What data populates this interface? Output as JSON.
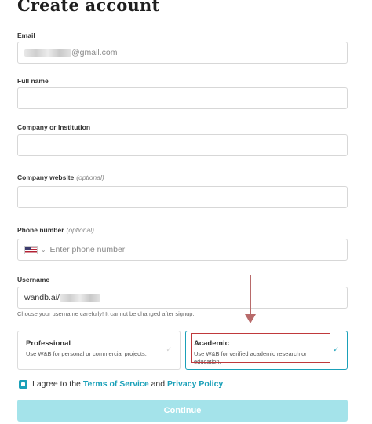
{
  "page": {
    "title": "Create account"
  },
  "fields": {
    "email": {
      "label": "Email",
      "value_suffix": "@gmail.com"
    },
    "full_name": {
      "label": "Full name",
      "value": ""
    },
    "company": {
      "label": "Company or Institution",
      "value": ""
    },
    "website": {
      "label": "Company website",
      "optional": "(optional)",
      "value": ""
    },
    "phone": {
      "label": "Phone number",
      "optional": "(optional)",
      "placeholder": "Enter phone number",
      "country_icon": "us-flag-icon",
      "chevron": "⌄"
    },
    "username": {
      "label": "Username",
      "prefix": "wandb.ai/",
      "hint": "Choose your username carefully! It cannot be changed after signup."
    }
  },
  "account_types": [
    {
      "title": "Professional",
      "description": "Use W&B for personal or commercial projects.",
      "selected": false
    },
    {
      "title": "Academic",
      "description": "Use W&B for verified academic research or education.",
      "selected": true
    }
  ],
  "agreement": {
    "prefix": "I agree to the",
    "terms": "Terms of Service",
    "and": "and",
    "privacy": "Privacy Policy",
    "suffix": ".",
    "checked": true
  },
  "continue_label": "Continue",
  "colors": {
    "accent": "#1aa0b8",
    "button": "#a4e3ea",
    "annotation_box": "#c0393b",
    "annotation_arrow": "#b86a6a"
  }
}
